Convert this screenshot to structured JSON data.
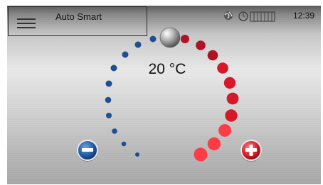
{
  "header": {
    "title": "Auto Smart",
    "time": "12:39",
    "status_icons": [
      "globe-icon",
      "timer-icon",
      "heater-icon"
    ]
  },
  "thermostat": {
    "setpoint_display": "20 °C",
    "setpoint_celsius": 20
  },
  "controls": {
    "decrease_icon": "minus-icon",
    "increase_icon": "plus-icon"
  },
  "colors": {
    "cold": "#1e4f93",
    "hot": "#d8172a",
    "knob": "#9c9c9c"
  }
}
